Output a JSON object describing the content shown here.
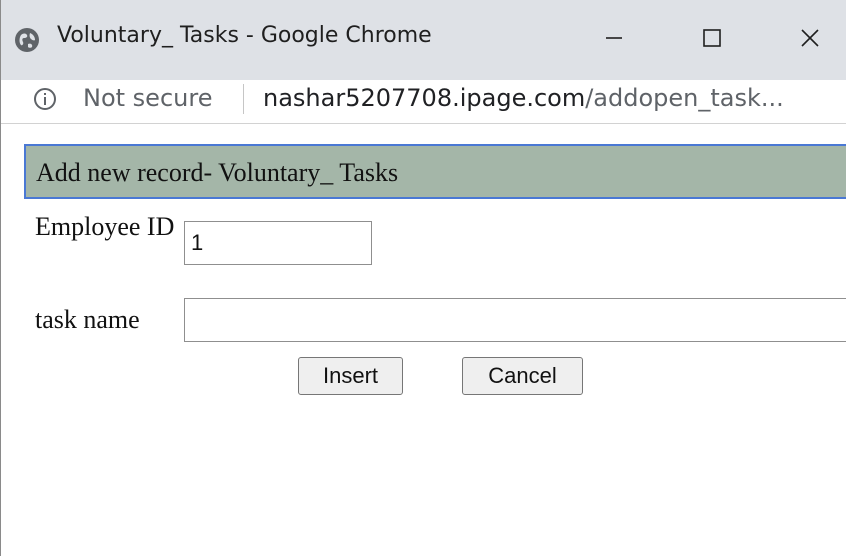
{
  "window": {
    "title": "Voluntary_ Tasks - Google Chrome",
    "icons": {
      "app": "globe-icon",
      "minimize": "minimize-icon",
      "maximize": "maximize-icon",
      "close": "close-icon"
    }
  },
  "addressbar": {
    "security_icon": "info-icon",
    "security_text": "Not secure",
    "url_host": "nashar5207708.ipage.com",
    "url_path": "/addopen_task..."
  },
  "form": {
    "header": "Add new record- Voluntary_ Tasks",
    "employee_id_label": "Employee ID",
    "employee_id_value": "1",
    "task_name_label": "task name",
    "task_name_value": "",
    "insert_label": "Insert",
    "cancel_label": "Cancel"
  },
  "colors": {
    "titlebar": "#dee1e6",
    "header_bg": "#a4b6a8",
    "header_border": "#4a78d4"
  }
}
